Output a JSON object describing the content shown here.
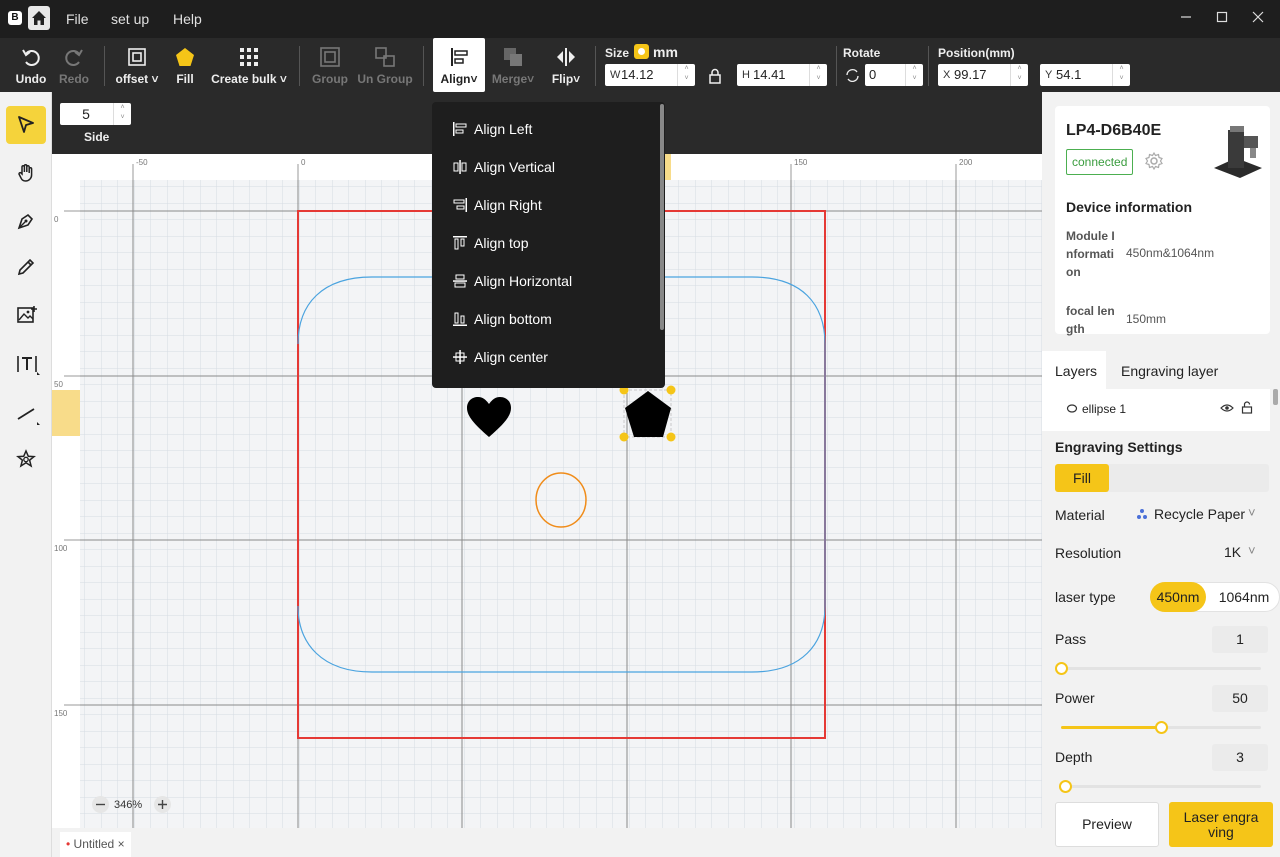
{
  "titlebar": {
    "logo": "B",
    "menus": [
      "File",
      "set up",
      "Help"
    ]
  },
  "toolbar": {
    "undo": "Undo",
    "redo": "Redo",
    "offset": "offset",
    "fill": "Fill",
    "create_bulk": "Create bulk",
    "group": "Group",
    "ungroup": "Un Group",
    "align": "Align",
    "merge": "Merge",
    "flip": "Flip",
    "size_label": "Size",
    "size_unit": "mm",
    "w_prefix": "W",
    "w_value": "14.12",
    "h_prefix": "H",
    "h_value": "14.41",
    "rotate_label": "Rotate",
    "rotate_value": "0",
    "position_label": "Position(mm)",
    "x_prefix": "X",
    "x_value": "99.17",
    "y_prefix": "Y",
    "y_value": "54.1"
  },
  "subbar": {
    "side_value": "5",
    "side_label": "Side"
  },
  "align_menu": {
    "items": [
      "Align Left",
      "Align Vertical",
      "Align Right",
      "Align top",
      "Align Horizontal",
      "Align bottom",
      "Align center"
    ]
  },
  "ruler": {
    "top": [
      "-50",
      "0",
      "150",
      "200"
    ],
    "left": [
      "0",
      "50",
      "100",
      "150"
    ]
  },
  "zoom": {
    "value": "346%"
  },
  "tab": {
    "marker": "•",
    "name": "Untitled",
    "close": "×"
  },
  "device": {
    "name": "LP4-D6B40E",
    "status": "connected",
    "info_title": "Device information",
    "module_label": "Module I nformati on",
    "module_value": "450nm&1064nm",
    "focal_label": "focal len gth",
    "focal_value": "150mm"
  },
  "layers": {
    "tab_layers": "Layers",
    "tab_engraving": "Engraving layer",
    "item": "ellipse 1"
  },
  "engraving": {
    "title": "Engraving Settings",
    "mode": "Fill",
    "material_label": "Material",
    "material_value": "Recycle Paper",
    "resolution_label": "Resolution",
    "resolution_value": "1K",
    "laser_label": "laser type",
    "laser_a": "450nm",
    "laser_b": "1064nm",
    "pass_label": "Pass",
    "pass_value": "1",
    "pass_fraction": 0,
    "power_label": "Power",
    "power_value": "50",
    "power_fraction": 0.5,
    "depth_label": "Depth",
    "depth_value": "3",
    "depth_fraction": 0.02,
    "preview": "Preview",
    "engrave": "Laser engra ving"
  },
  "colors": {
    "accent": "#f5c518",
    "outline": "#e53935",
    "blue": "#4aa3df",
    "orange": "#f08c1a"
  }
}
